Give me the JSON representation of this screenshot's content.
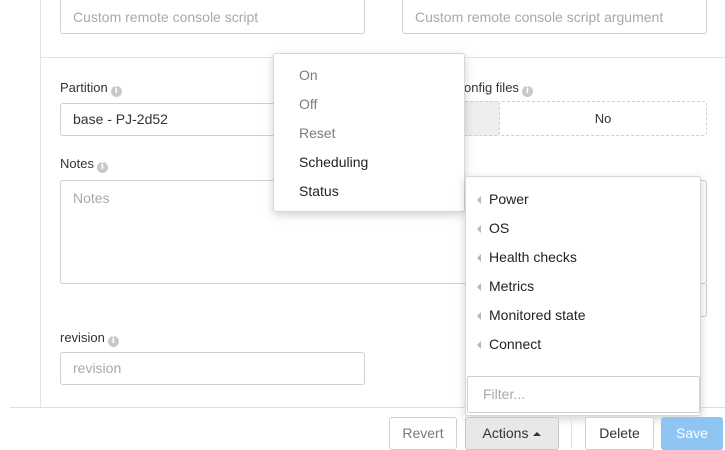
{
  "top": {
    "script_placeholder": "Custom remote console script",
    "args_placeholder": "Custom remote console script argument"
  },
  "partition": {
    "label": "Partition",
    "value": "base - PJ-2d52"
  },
  "config_files": {
    "label": "onfig files",
    "toggle_right": "No"
  },
  "notes": {
    "label": "Notes",
    "placeholder": "Notes"
  },
  "revision": {
    "label": "revision",
    "placeholder": "revision"
  },
  "power_menu": {
    "items": [
      "On",
      "Off",
      "Reset",
      "Scheduling",
      "Status"
    ]
  },
  "actions_menu": {
    "items": [
      "Power",
      "OS",
      "Health checks",
      "Metrics",
      "Monitored state",
      "Connect"
    ],
    "filter_placeholder": "Filter..."
  },
  "footer": {
    "revert": "Revert",
    "actions": "Actions",
    "delete": "Delete",
    "save": "Save"
  },
  "icons": {
    "info": "info-icon",
    "submenu": "triangle-left-icon",
    "caret": "caret-up-icon"
  },
  "colors": {
    "save_bg": "#8ec5f2",
    "active_bg": "#e8e8e8"
  }
}
